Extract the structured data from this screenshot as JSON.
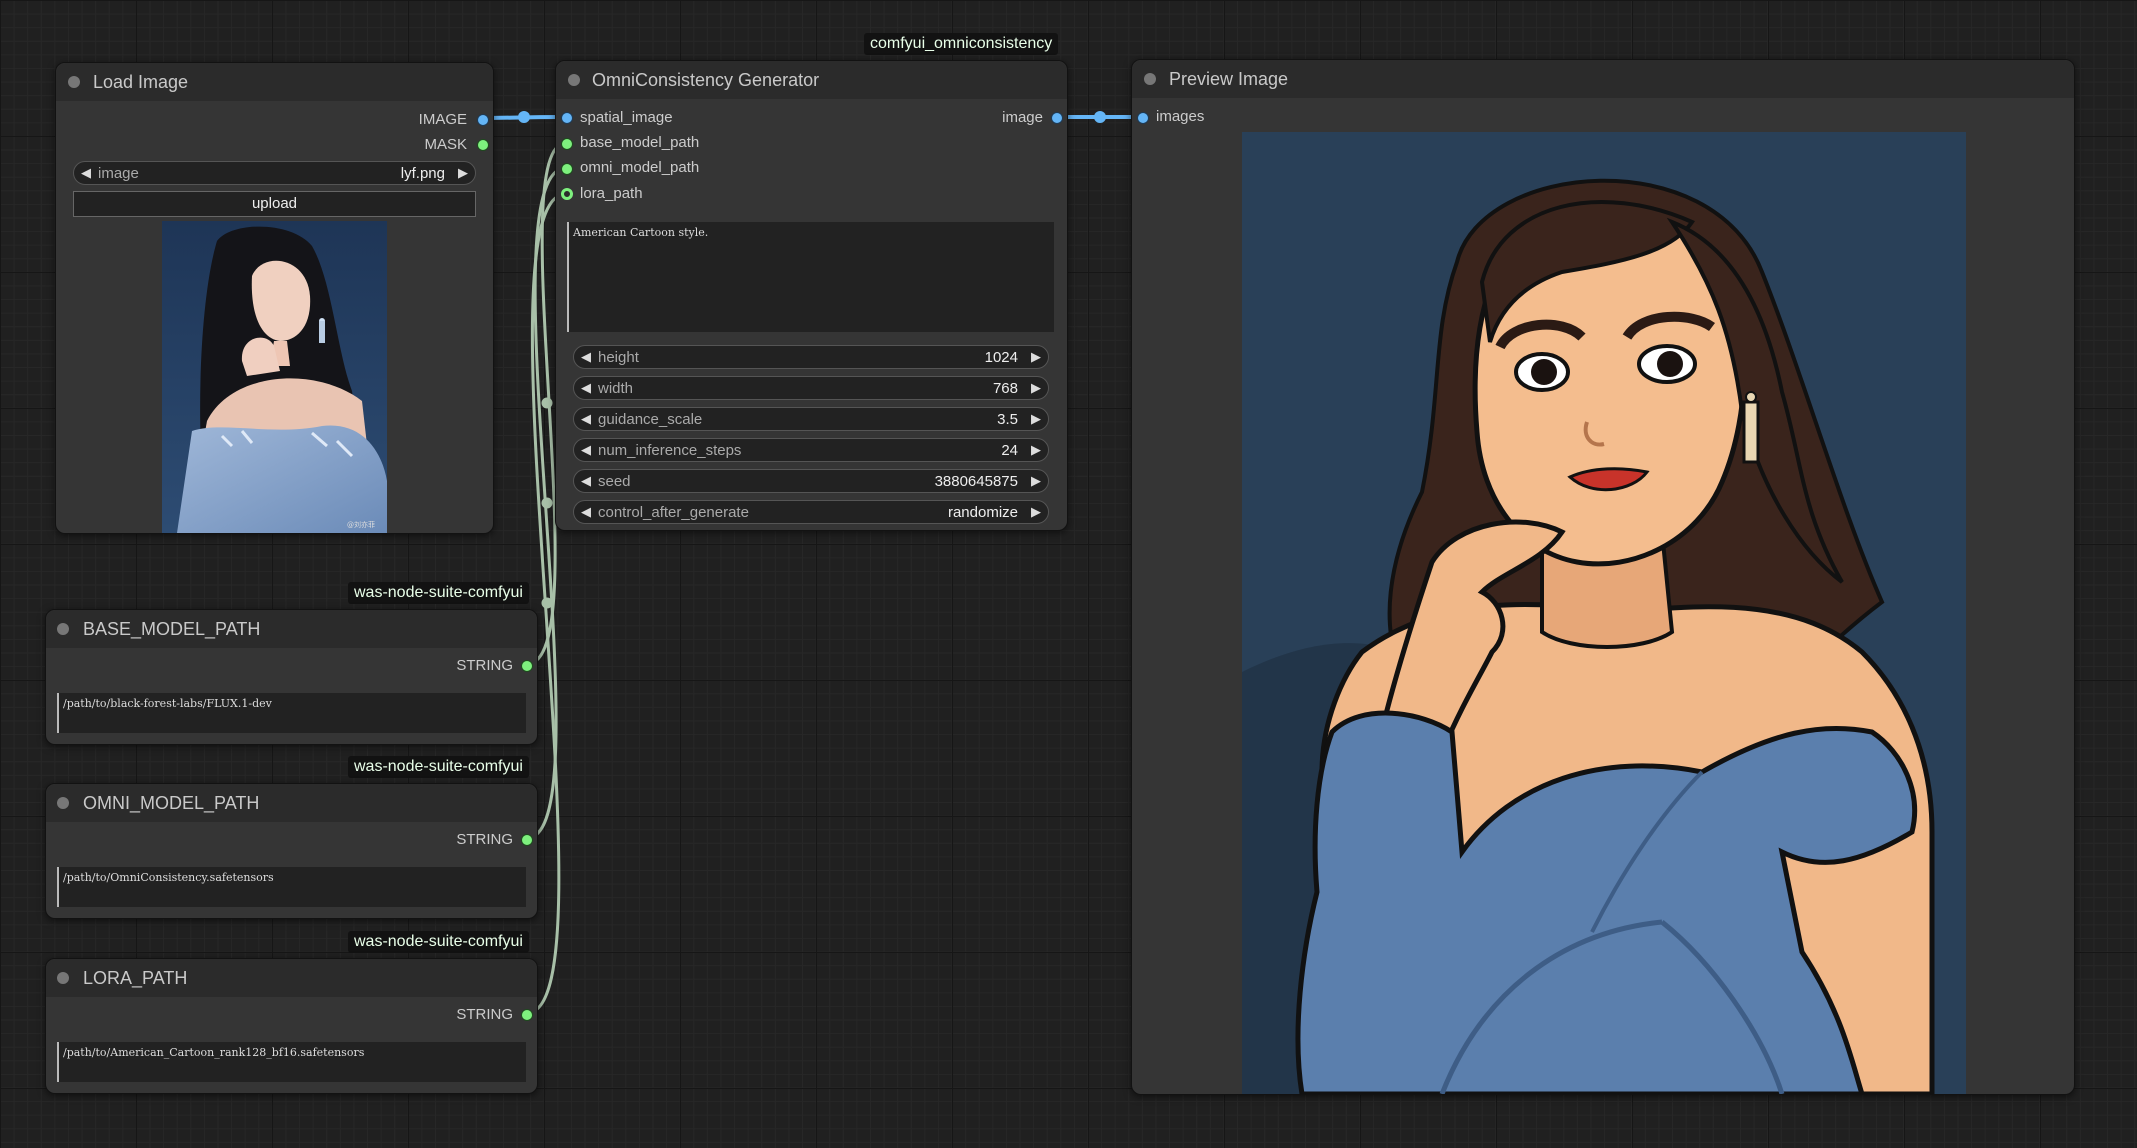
{
  "colors": {
    "image_link": "#64b5f6",
    "string_link": "#a8c0a8",
    "string_port": "#7ef07e",
    "badge_text": "#e9ffe9"
  },
  "load_image": {
    "title": "Load Image",
    "outputs": [
      "IMAGE",
      "MASK"
    ],
    "image_widget": {
      "name": "image",
      "value": "lyf.png"
    },
    "upload_label": "upload",
    "thumbnail_caption": "@刘亦菲"
  },
  "generator": {
    "badge": "comfyui_omniconsistency",
    "title": "OmniConsistency Generator",
    "inputs": [
      "spatial_image",
      "base_model_path",
      "omni_model_path",
      "lora_path"
    ],
    "output": "image",
    "prompt": "American Cartoon style.",
    "widgets": [
      {
        "name": "height",
        "value": "1024"
      },
      {
        "name": "width",
        "value": "768"
      },
      {
        "name": "guidance_scale",
        "value": "3.5"
      },
      {
        "name": "num_inference_steps",
        "value": "24"
      },
      {
        "name": "seed",
        "value": "3880645875"
      },
      {
        "name": "control_after_generate",
        "value": "randomize"
      }
    ]
  },
  "preview": {
    "title": "Preview Image",
    "input": "images"
  },
  "string_nodes": [
    {
      "badge": "was-node-suite-comfyui",
      "title": "BASE_MODEL_PATH",
      "output": "STRING",
      "text": "/path/to/black-forest-labs/FLUX.1-dev"
    },
    {
      "badge": "was-node-suite-comfyui",
      "title": "OMNI_MODEL_PATH",
      "output": "STRING",
      "text": "/path/to/OmniConsistency.safetensors"
    },
    {
      "badge": "was-node-suite-comfyui",
      "title": "LORA_PATH",
      "output": "STRING",
      "text": "/path/to/American_Cartoon_rank128_bf16.safetensors"
    }
  ]
}
